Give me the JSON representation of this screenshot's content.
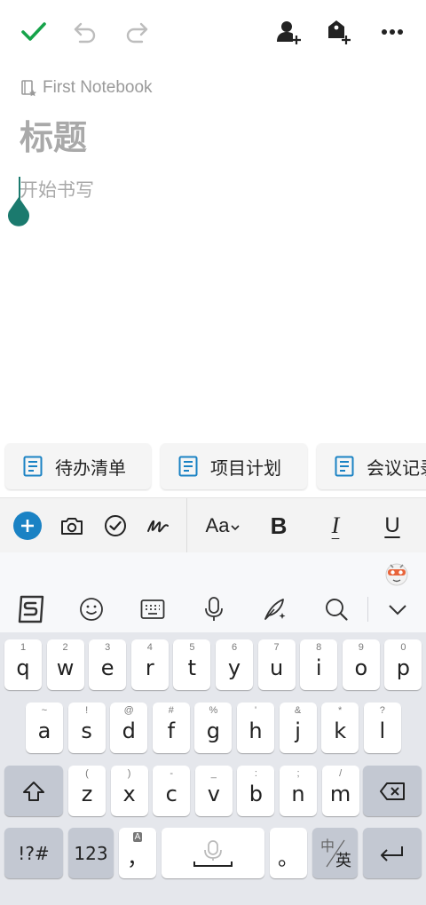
{
  "notebook": {
    "name": "First Notebook"
  },
  "note": {
    "title_placeholder": "标题",
    "body_placeholder": "开始书写"
  },
  "templates": [
    {
      "label": "待办清单"
    },
    {
      "label": "项目计划"
    },
    {
      "label": "会议记录"
    }
  ],
  "format_toolbar": {
    "font_label": "Aa",
    "bold_label": "B",
    "italic_label": "I",
    "underline_label": "U"
  },
  "keyboard": {
    "row1": [
      {
        "main": "q",
        "sub": "1"
      },
      {
        "main": "w",
        "sub": "2"
      },
      {
        "main": "e",
        "sub": "3"
      },
      {
        "main": "r",
        "sub": "4"
      },
      {
        "main": "t",
        "sub": "5"
      },
      {
        "main": "y",
        "sub": "6"
      },
      {
        "main": "u",
        "sub": "7"
      },
      {
        "main": "i",
        "sub": "8"
      },
      {
        "main": "o",
        "sub": "9"
      },
      {
        "main": "p",
        "sub": "0"
      }
    ],
    "row2": [
      {
        "main": "a",
        "sub": "~"
      },
      {
        "main": "s",
        "sub": "!"
      },
      {
        "main": "d",
        "sub": "@"
      },
      {
        "main": "f",
        "sub": "#"
      },
      {
        "main": "g",
        "sub": "%"
      },
      {
        "main": "h",
        "sub": "'"
      },
      {
        "main": "j",
        "sub": "&"
      },
      {
        "main": "k",
        "sub": "*"
      },
      {
        "main": "l",
        "sub": "?"
      }
    ],
    "row3": [
      {
        "main": "z",
        "sub": "("
      },
      {
        "main": "x",
        "sub": ")"
      },
      {
        "main": "c",
        "sub": "-"
      },
      {
        "main": "v",
        "sub": "_"
      },
      {
        "main": "b",
        "sub": ":"
      },
      {
        "main": "n",
        "sub": ";"
      },
      {
        "main": "m",
        "sub": "/"
      }
    ],
    "symbols_label": "!?#",
    "numbers_label": "123",
    "comma_label": "，",
    "comma_sub": "A",
    "period_label": "。",
    "lang_top": "中",
    "lang_bottom": "英"
  },
  "colors": {
    "accent_green": "#16a34a",
    "template_blue": "#1a82c4",
    "caret_teal": "#1b7a6e"
  }
}
